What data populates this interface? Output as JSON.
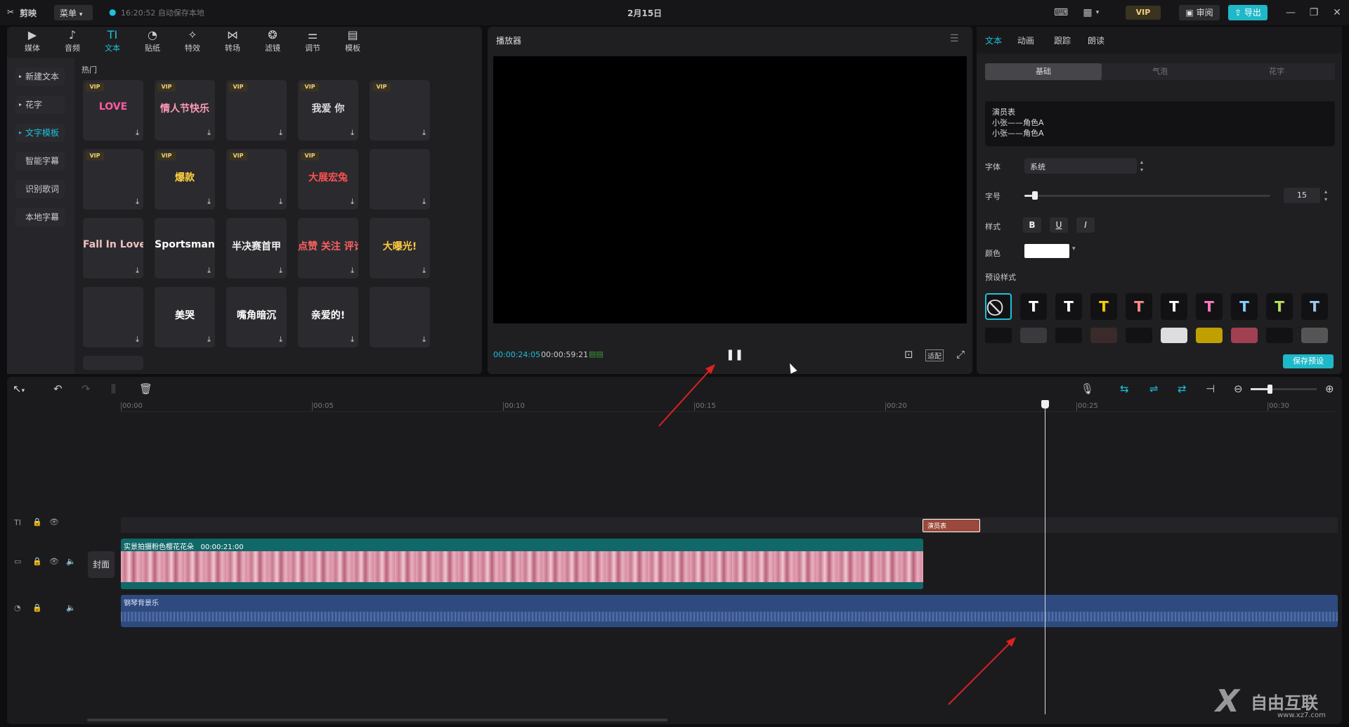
{
  "titlebar": {
    "app_name": "剪映",
    "menu": "菜单",
    "autosave": "16:20:52 自动保存本地",
    "project_title": "2月15日",
    "vip": "VIP",
    "review": "审阅",
    "export": "导出"
  },
  "left_tabs": [
    {
      "label": "媒体",
      "icon": "media-icon"
    },
    {
      "label": "音频",
      "icon": "audio-icon"
    },
    {
      "label": "文本",
      "icon": "text-icon"
    },
    {
      "label": "贴纸",
      "icon": "sticker-icon"
    },
    {
      "label": "特效",
      "icon": "effects-icon"
    },
    {
      "label": "转场",
      "icon": "transition-icon"
    },
    {
      "label": "滤镜",
      "icon": "filter-icon"
    },
    {
      "label": "调节",
      "icon": "adjust-icon"
    },
    {
      "label": "模板",
      "icon": "template-icon"
    }
  ],
  "side_categories": [
    "新建文本",
    "花字",
    "文字模板",
    "智能字幕",
    "识别歌词",
    "本地字幕"
  ],
  "section_title": "热门",
  "templates": [
    "LOVE",
    "情人节快乐",
    "",
    "我爱 你",
    "",
    "",
    "爆款",
    "",
    "大展宏兔",
    "",
    "Fall In Love",
    "Sportsman",
    "半决赛首甲",
    "点赞 关注 评论",
    "大曝光!",
    "",
    "美哭",
    "嘴角暗沉",
    "亲爱的!",
    "",
    ""
  ],
  "player": {
    "title": "播放器",
    "current_time": "00:00:24:05",
    "total_time": "00:00:59:21",
    "ratio": "适配"
  },
  "right_tabs": [
    "文本",
    "动画",
    "跟踪",
    "朗读"
  ],
  "sub_tabs": [
    "基础",
    "气泡",
    "花字"
  ],
  "text_content": [
    "演员表",
    "小张——角色A",
    "小张——角色A"
  ],
  "font_label": "字体",
  "font_value": "系统",
  "size_label": "字号",
  "size_value": "15",
  "style_label": "样式",
  "bold": "B",
  "underline": "U",
  "italic": "I",
  "color_label": "颜色",
  "color_value": "#ffffff",
  "preset_label": "预设样式",
  "save_preset": "保存预设",
  "presets": [
    {
      "glyph": "T",
      "color": "#ffffff"
    },
    {
      "glyph": "T",
      "color": "#ffffff"
    },
    {
      "glyph": "T",
      "color": "#f5d000"
    },
    {
      "glyph": "T",
      "color": "#ff8a8a"
    },
    {
      "glyph": "T",
      "color": "#ffffff"
    },
    {
      "glyph": "T",
      "color": "#ff7ac0"
    },
    {
      "glyph": "T",
      "color": "#80d0ff"
    },
    {
      "glyph": "T",
      "color": "#b8e060"
    },
    {
      "glyph": "T",
      "color": "#a0c8f0"
    }
  ],
  "ruler": [
    "00:00",
    "00:05",
    "00:10",
    "00:15",
    "00:20",
    "00:25",
    "00:30"
  ],
  "tracks": {
    "text_clip": "演员表",
    "cover": "封面",
    "video_clip_name": "实景拍摄粉色樱花花朵",
    "video_clip_duration": "00:00:21:00",
    "audio_clip": "钢琴背景乐"
  },
  "watermark": "自由互联",
  "watermark_url": "www.xz7.com"
}
